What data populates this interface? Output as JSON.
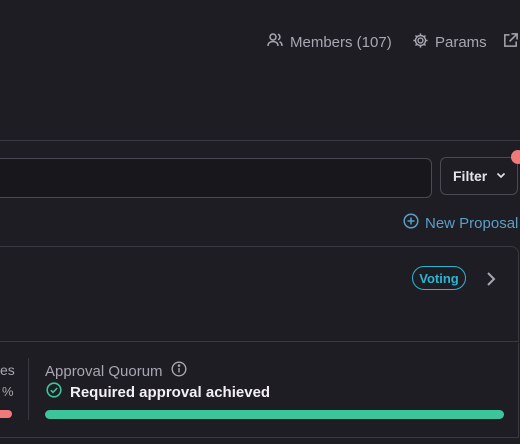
{
  "topnav": {
    "members_label": "Members (107)",
    "params_label": "Params",
    "icons": {
      "members": "users-icon",
      "params": "gear-icon",
      "external": "external-link-icon"
    }
  },
  "search": {
    "value": "",
    "placeholder": ""
  },
  "filter": {
    "label": "Filter",
    "icon": "chevron-down-icon",
    "badge_color": "#f07a7a"
  },
  "new_proposal": {
    "label": "New Proposal",
    "icon": "plus-circle-icon"
  },
  "proposal": {
    "status_badge": "Voting",
    "status_color": "#2bb5d1",
    "left_fragment_label": "es",
    "left_fragment_value": "%",
    "approval_quorum": {
      "title": "Approval Quorum",
      "status": "Required approval achieved",
      "progress": 1.0,
      "progress_color": "#3cc59a"
    }
  },
  "colors": {
    "background": "#1e1d23",
    "accent": "#5a9fc7",
    "muted_text": "#a8a6b0"
  }
}
